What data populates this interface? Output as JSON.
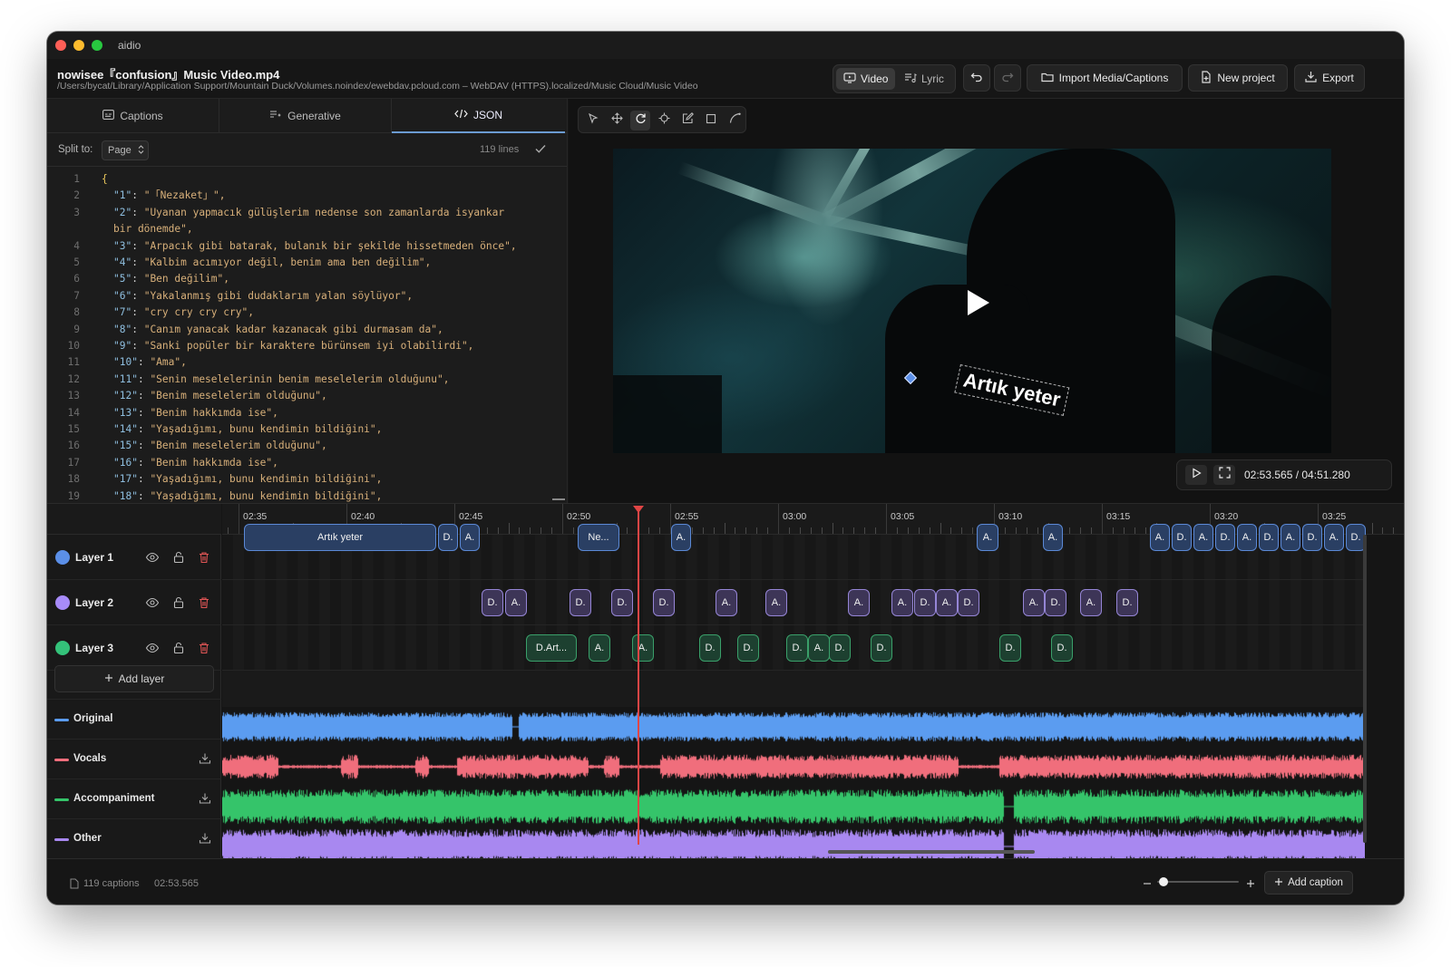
{
  "app": {
    "title": "aidio"
  },
  "file": {
    "title": "nowisee『confusion』Music Video.mp4",
    "path": "/Users/bycat/Library/Application Support/Mountain Duck/Volumes.noindex/ewebdav.pcloud.com – WebDAV (HTTPS).localized/Music Cloud/Music Video"
  },
  "header": {
    "mode_video": "Video",
    "mode_lyric": "Lyric",
    "active_mode": "Video",
    "import_label": "Import Media/Captions",
    "new_project_label": "New project",
    "export_label": "Export"
  },
  "editor": {
    "tabs": [
      {
        "label": "Captions",
        "icon": "captions-icon"
      },
      {
        "label": "Generative",
        "icon": "generative-icon"
      },
      {
        "label": "JSON",
        "icon": "code-icon"
      }
    ],
    "active_tab": "JSON",
    "split_label": "Split to:",
    "split_value": "Page",
    "line_count": "119 lines",
    "lines": [
      {
        "n": "1",
        "key": "",
        "val": "{"
      },
      {
        "n": "2",
        "key": "\"1\"",
        "val": "\"「Nezaket」\","
      },
      {
        "n": "3",
        "key": "\"2\"",
        "val": "\"Uyanan yapmacık gülüşlerim nedense son zamanlarda isyankar"
      },
      {
        "n": "",
        "key": "",
        "val": "bir dönemde\","
      },
      {
        "n": "4",
        "key": "\"3\"",
        "val": "\"Arpacık gibi batarak, bulanık bir şekilde hissetmeden önce\","
      },
      {
        "n": "5",
        "key": "\"4\"",
        "val": "\"Kalbim acımıyor değil, benim ama ben değilim\","
      },
      {
        "n": "6",
        "key": "\"5\"",
        "val": "\"Ben değilim\","
      },
      {
        "n": "7",
        "key": "\"6\"",
        "val": "\"Yakalanmış gibi dudaklarım yalan söylüyor\","
      },
      {
        "n": "8",
        "key": "\"7\"",
        "val": "\"cry cry cry cry\","
      },
      {
        "n": "9",
        "key": "\"8\"",
        "val": "\"Canım yanacak kadar kazanacak gibi durmasam da\","
      },
      {
        "n": "10",
        "key": "\"9\"",
        "val": "\"Sanki popüler bir karaktere bürünsem iyi olabilirdi\","
      },
      {
        "n": "11",
        "key": "\"10\"",
        "val": "\"Ama\","
      },
      {
        "n": "12",
        "key": "\"11\"",
        "val": "\"Senin meselelerinin benim meselelerim olduğunu\","
      },
      {
        "n": "13",
        "key": "\"12\"",
        "val": "\"Benim meselelerim olduğunu\","
      },
      {
        "n": "14",
        "key": "\"13\"",
        "val": "\"Benim hakkımda ise\","
      },
      {
        "n": "15",
        "key": "\"14\"",
        "val": "\"Yaşadığımı, bunu kendimin bildiğini\","
      },
      {
        "n": "16",
        "key": "\"15\"",
        "val": "\"Benim meselelerim olduğunu\","
      },
      {
        "n": "17",
        "key": "\"16\"",
        "val": "\"Benim hakkımda ise\","
      },
      {
        "n": "18",
        "key": "\"17\"",
        "val": "\"Yaşadığımı, bunu kendimin bildiğini\","
      },
      {
        "n": "19",
        "key": "\"18\"",
        "val": "\"Yaşadığımı, bunu kendimin bildiğini\","
      }
    ]
  },
  "preview": {
    "caption_text": "Artık yeter",
    "time": "02:53.565 / 04:51.280"
  },
  "timeline": {
    "ruler_labels": [
      "02:35",
      "02:40",
      "02:45",
      "02:50",
      "02:55",
      "03:00",
      "03:05",
      "03:10",
      "03:15",
      "03:20",
      "03:25"
    ],
    "layers": [
      {
        "name": "Layer 1",
        "color": "#5b8fe8"
      },
      {
        "name": "Layer 2",
        "color": "#a78bfa"
      },
      {
        "name": "Layer 3",
        "color": "#34c27a"
      }
    ],
    "add_layer_label": "Add layer",
    "layer1_clips": [
      "Artık yeter",
      "D.",
      "A.",
      "Ne...",
      "A.",
      "A.",
      "A.",
      "A.",
      "D.",
      "A.",
      "D.",
      "A.",
      "D.",
      "A.",
      "D.",
      "A.",
      "D."
    ],
    "layer2_clips": [
      "D.",
      "A.",
      "D.",
      "D.",
      "D.",
      "A.",
      "A.",
      "A.",
      "A.",
      "D.",
      "A.",
      "D.",
      "A.",
      "D.",
      "A.",
      "D."
    ],
    "layer3_clips": [
      "D.Art...",
      "A.",
      "A.",
      "D.",
      "D.",
      "D.",
      "A.",
      "D.",
      "D.",
      "D.",
      "D."
    ],
    "audio": [
      {
        "name": "Original",
        "color": "#5b9cf0",
        "download": false
      },
      {
        "name": "Vocals",
        "color": "#f06e7c",
        "download": true
      },
      {
        "name": "Accompaniment",
        "color": "#35c46a",
        "download": true
      },
      {
        "name": "Other",
        "color": "#a888f0",
        "download": true
      }
    ]
  },
  "status": {
    "captions_count": "119 captions",
    "position": "02:53.565",
    "zoom_level": 0.08,
    "add_caption_label": "Add caption"
  }
}
